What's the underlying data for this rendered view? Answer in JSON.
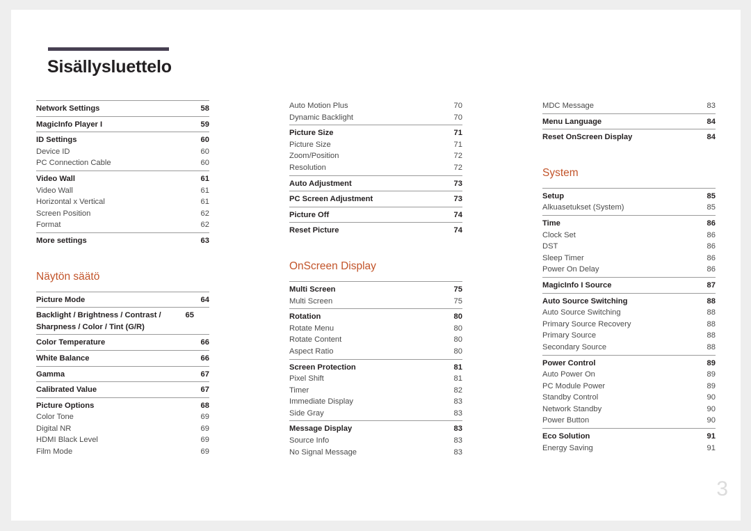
{
  "document": {
    "title": "Sisällysluettelo",
    "folio": "3",
    "accent_color": "#c2542a",
    "rule_color": "#474052"
  },
  "columns": [
    {
      "name": "column-left",
      "blocks": [
        {
          "type": "group",
          "divider": "dark",
          "rows": [
            {
              "label": "Network Settings",
              "page": "58",
              "level": "bold"
            }
          ]
        },
        {
          "type": "group",
          "divider": "dark",
          "rows": [
            {
              "label": "MagicInfo Player I",
              "page": "59",
              "level": "bold"
            }
          ]
        },
        {
          "type": "group",
          "divider": "dark",
          "rows": [
            {
              "label": "ID Settings",
              "page": "60",
              "level": "bold"
            },
            {
              "label": "Device ID",
              "page": "60",
              "level": "sub"
            },
            {
              "label": "PC Connection Cable",
              "page": "60",
              "level": "sub"
            }
          ]
        },
        {
          "type": "group",
          "divider": "dark",
          "rows": [
            {
              "label": "Video Wall",
              "page": "61",
              "level": "bold"
            },
            {
              "label": "Video Wall",
              "page": "61",
              "level": "sub"
            },
            {
              "label": "Horizontal x Vertical",
              "page": "61",
              "level": "sub"
            },
            {
              "label": "Screen Position",
              "page": "62",
              "level": "sub"
            },
            {
              "label": "Format",
              "page": "62",
              "level": "sub"
            }
          ]
        },
        {
          "type": "group",
          "divider": "dark",
          "rows": [
            {
              "label": "More settings",
              "page": "63",
              "level": "bold"
            }
          ]
        },
        {
          "type": "spacer"
        },
        {
          "type": "section",
          "heading": "Näytön säätö"
        },
        {
          "type": "group",
          "divider": "dark",
          "rows": [
            {
              "label": "Picture Mode",
              "page": "64",
              "level": "bold"
            }
          ]
        },
        {
          "type": "group",
          "divider": "dark",
          "rows": [
            {
              "label": "Backlight / Brightness / Contrast / Sharpness / Color / Tint (G/R)",
              "page": "65",
              "level": "bold",
              "wrap": true
            }
          ]
        },
        {
          "type": "group",
          "divider": "dark",
          "rows": [
            {
              "label": "Color Temperature",
              "page": "66",
              "level": "bold"
            }
          ]
        },
        {
          "type": "group",
          "divider": "dark",
          "rows": [
            {
              "label": "White Balance",
              "page": "66",
              "level": "bold"
            }
          ]
        },
        {
          "type": "group",
          "divider": "dark",
          "rows": [
            {
              "label": "Gamma",
              "page": "67",
              "level": "bold"
            }
          ]
        },
        {
          "type": "group",
          "divider": "dark",
          "rows": [
            {
              "label": "Calibrated Value",
              "page": "67",
              "level": "bold"
            }
          ]
        },
        {
          "type": "group",
          "divider": "dark",
          "rows": [
            {
              "label": "Picture Options",
              "page": "68",
              "level": "bold"
            },
            {
              "label": "Color Tone",
              "page": "69",
              "level": "sub"
            },
            {
              "label": "Digital NR",
              "page": "69",
              "level": "sub"
            },
            {
              "label": "HDMI Black Level",
              "page": "69",
              "level": "sub"
            },
            {
              "label": "Film Mode",
              "page": "69",
              "level": "sub"
            }
          ]
        }
      ]
    },
    {
      "name": "column-middle",
      "blocks": [
        {
          "type": "group",
          "divider": "none",
          "rows": [
            {
              "label": "Auto Motion Plus",
              "page": "70",
              "level": "sub"
            },
            {
              "label": "Dynamic Backlight",
              "page": "70",
              "level": "sub"
            }
          ]
        },
        {
          "type": "group",
          "divider": "dark",
          "rows": [
            {
              "label": "Picture Size",
              "page": "71",
              "level": "bold"
            },
            {
              "label": "Picture Size",
              "page": "71",
              "level": "sub"
            },
            {
              "label": "Zoom/Position",
              "page": "72",
              "level": "sub"
            },
            {
              "label": "Resolution",
              "page": "72",
              "level": "sub"
            }
          ]
        },
        {
          "type": "group",
          "divider": "dark",
          "rows": [
            {
              "label": "Auto Adjustment",
              "page": "73",
              "level": "bold"
            }
          ]
        },
        {
          "type": "group",
          "divider": "dark",
          "rows": [
            {
              "label": "PC Screen Adjustment",
              "page": "73",
              "level": "bold"
            }
          ]
        },
        {
          "type": "group",
          "divider": "dark",
          "rows": [
            {
              "label": "Picture Off",
              "page": "74",
              "level": "bold"
            }
          ]
        },
        {
          "type": "group",
          "divider": "dark",
          "rows": [
            {
              "label": "Reset Picture",
              "page": "74",
              "level": "bold"
            }
          ]
        },
        {
          "type": "spacer"
        },
        {
          "type": "section",
          "heading": "OnScreen Display"
        },
        {
          "type": "group",
          "divider": "dark",
          "rows": [
            {
              "label": "Multi Screen",
              "page": "75",
              "level": "bold"
            },
            {
              "label": "Multi Screen",
              "page": "75",
              "level": "sub"
            }
          ]
        },
        {
          "type": "group",
          "divider": "dark",
          "rows": [
            {
              "label": "Rotation",
              "page": "80",
              "level": "bold"
            },
            {
              "label": "Rotate Menu",
              "page": "80",
              "level": "sub"
            },
            {
              "label": "Rotate Content",
              "page": "80",
              "level": "sub"
            },
            {
              "label": "Aspect Ratio",
              "page": "80",
              "level": "sub"
            }
          ]
        },
        {
          "type": "group",
          "divider": "dark",
          "rows": [
            {
              "label": "Screen Protection",
              "page": "81",
              "level": "bold"
            },
            {
              "label": "Pixel Shift",
              "page": "81",
              "level": "sub"
            },
            {
              "label": "Timer",
              "page": "82",
              "level": "sub"
            },
            {
              "label": "Immediate Display",
              "page": "83",
              "level": "sub"
            },
            {
              "label": "Side Gray",
              "page": "83",
              "level": "sub"
            }
          ]
        },
        {
          "type": "group",
          "divider": "dark",
          "rows": [
            {
              "label": "Message Display",
              "page": "83",
              "level": "bold"
            },
            {
              "label": "Source Info",
              "page": "83",
              "level": "sub"
            },
            {
              "label": "No Signal Message",
              "page": "83",
              "level": "sub"
            }
          ]
        }
      ]
    },
    {
      "name": "column-right",
      "blocks": [
        {
          "type": "group",
          "divider": "none",
          "rows": [
            {
              "label": "MDC Message",
              "page": "83",
              "level": "sub"
            }
          ]
        },
        {
          "type": "group",
          "divider": "dark",
          "rows": [
            {
              "label": "Menu Language",
              "page": "84",
              "level": "bold"
            }
          ]
        },
        {
          "type": "group",
          "divider": "dark",
          "rows": [
            {
              "label": "Reset OnScreen Display",
              "page": "84",
              "level": "bold"
            }
          ]
        },
        {
          "type": "spacer"
        },
        {
          "type": "section",
          "heading": "System"
        },
        {
          "type": "group",
          "divider": "dark",
          "rows": [
            {
              "label": "Setup",
              "page": "85",
              "level": "bold"
            },
            {
              "label": "Alkuasetukset (System)",
              "page": "85",
              "level": "sub"
            }
          ]
        },
        {
          "type": "group",
          "divider": "dark",
          "rows": [
            {
              "label": "Time",
              "page": "86",
              "level": "bold"
            },
            {
              "label": "Clock Set",
              "page": "86",
              "level": "sub"
            },
            {
              "label": "DST",
              "page": "86",
              "level": "sub"
            },
            {
              "label": "Sleep Timer",
              "page": "86",
              "level": "sub"
            },
            {
              "label": "Power On Delay",
              "page": "86",
              "level": "sub"
            }
          ]
        },
        {
          "type": "group",
          "divider": "dark",
          "rows": [
            {
              "label": "MagicInfo I Source",
              "page": "87",
              "level": "bold"
            }
          ]
        },
        {
          "type": "group",
          "divider": "dark",
          "rows": [
            {
              "label": "Auto Source Switching",
              "page": "88",
              "level": "bold"
            },
            {
              "label": "Auto Source Switching",
              "page": "88",
              "level": "sub"
            },
            {
              "label": "Primary Source Recovery",
              "page": "88",
              "level": "sub"
            },
            {
              "label": "Primary Source",
              "page": "88",
              "level": "sub"
            },
            {
              "label": "Secondary Source",
              "page": "88",
              "level": "sub"
            }
          ]
        },
        {
          "type": "group",
          "divider": "dark",
          "rows": [
            {
              "label": "Power Control",
              "page": "89",
              "level": "bold"
            },
            {
              "label": "Auto Power On",
              "page": "89",
              "level": "sub"
            },
            {
              "label": "PC Module Power",
              "page": "89",
              "level": "sub"
            },
            {
              "label": "Standby Control",
              "page": "90",
              "level": "sub"
            },
            {
              "label": "Network Standby",
              "page": "90",
              "level": "sub"
            },
            {
              "label": "Power Button",
              "page": "90",
              "level": "sub"
            }
          ]
        },
        {
          "type": "group",
          "divider": "dark",
          "rows": [
            {
              "label": "Eco Solution",
              "page": "91",
              "level": "bold"
            },
            {
              "label": "Energy Saving",
              "page": "91",
              "level": "sub"
            }
          ]
        }
      ]
    }
  ]
}
